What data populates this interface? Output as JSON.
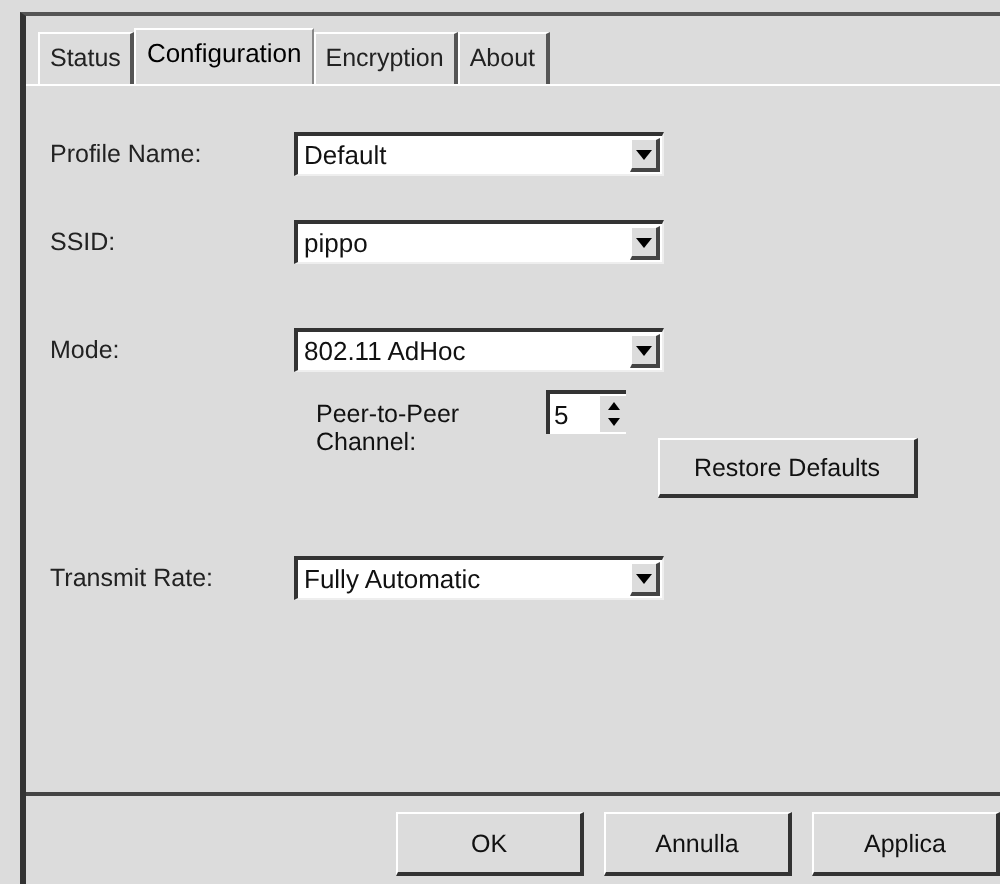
{
  "tabs": [
    {
      "label": "Status",
      "selected": false
    },
    {
      "label": "Configuration",
      "selected": true
    },
    {
      "label": "Encryption",
      "selected": false
    },
    {
      "label": "About",
      "selected": false
    }
  ],
  "profile_name": {
    "label": "Profile Name:",
    "value": "Default"
  },
  "ssid": {
    "label": "SSID:",
    "value": "pippo"
  },
  "mode": {
    "label": "Mode:",
    "value": "802.11 AdHoc"
  },
  "peer_channel": {
    "label": "Peer-to-Peer Channel:",
    "value": "5"
  },
  "restore_button": "Restore Defaults",
  "transmit_rate": {
    "label": "Transmit Rate:",
    "value": "Fully Automatic"
  },
  "buttons": [
    "OK",
    "Annulla",
    "Applica"
  ]
}
